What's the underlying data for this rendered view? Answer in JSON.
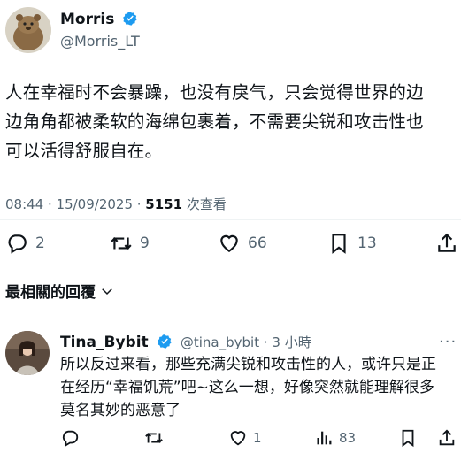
{
  "post": {
    "author_name": "Morris",
    "author_handle": "@Morris_LT",
    "text_line1": "人在幸福时不会暴躁，也没有戾气，只会觉得世界的边",
    "text_line2": "边角角都被柔软的海绵包裹着，不需要尖锐和攻击性也",
    "text_line3": "可以活得舒服自在。",
    "time": "08:44 · 15/09/2025 · ",
    "views_count": "5151",
    "views_label": " 次查看"
  },
  "actions": {
    "replies": "2",
    "reposts": "9",
    "likes": "66",
    "bookmarks": "13"
  },
  "sort": {
    "label": "最相關的回覆"
  },
  "reply": {
    "author_name": "Tina_Bybit",
    "author_handle": "@tina_bybit · 3 小時",
    "text_line1": "所以反过来看，那些充满尖锐和攻击性的人，或许只是正",
    "text_line2": "在经历“幸福饥荒”吧~这么一想，好像突然就能理解很多",
    "text_line3": "莫名其妙的恶意了",
    "likes": "1",
    "views": "83"
  },
  "colors": {
    "verified": "#1d9bf0",
    "muted": "#536471",
    "text": "#0f1419"
  }
}
